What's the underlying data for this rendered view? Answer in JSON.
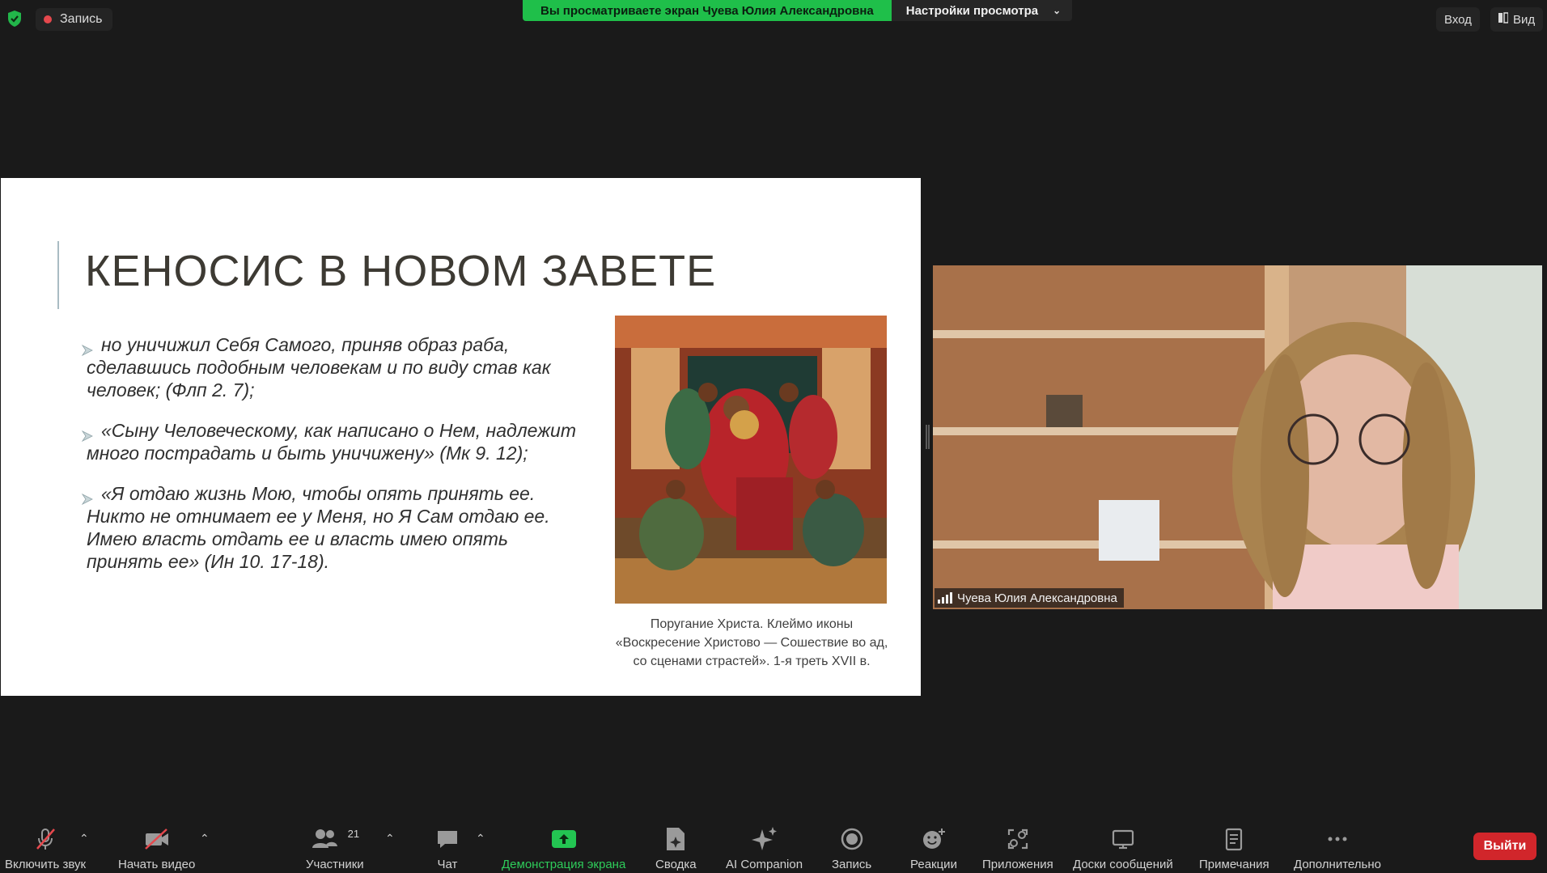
{
  "top_bar": {
    "recording_label": "Запись",
    "share_banner_text": "Вы просматриваете экран Чуева Юлия Александровна",
    "view_settings_label": "Настройки просмотра",
    "sign_in_label": "Вход",
    "view_label": "Вид"
  },
  "slide": {
    "title": "КЕНОСИС В НОВОМ ЗАВЕТЕ",
    "bullets": [
      "но уничижил Себя Самого, приняв образ раба, сделавшись подобным человекам и по виду став как человек; (Флп 2. 7);",
      "«Сыну Человеческому, как написано о Нем, надлежит много пострадать и быть уничижену» (Мк 9. 12);",
      "«Я отдаю жизнь Мою, чтобы опять принять ее. Никто не отнимает ее у Меня, но Я Сам отдаю ее. Имею власть отдать ее и власть имею опять принять ее» (Ин 10. 17-18)."
    ],
    "caption_lines": [
      "Поругание Христа. Клеймо иконы",
      "«Воскресение Христово — Сошествие во ад,",
      "со сценами страстей». 1-я треть XVII в."
    ]
  },
  "video": {
    "participant_name": "Чуева Юлия Александровна"
  },
  "toolbar": {
    "unmute_label": "Включить звук",
    "start_video_label": "Начать видео",
    "participants_label": "Участники",
    "participants_count": "21",
    "chat_label": "Чат",
    "share_screen_label": "Демонстрация экрана",
    "summary_label": "Сводка",
    "ai_label": "AI Companion",
    "record_label": "Запись",
    "reactions_label": "Реакции",
    "apps_label": "Приложения",
    "whiteboards_label": "Доски сообщений",
    "notes_label": "Примечания",
    "more_label": "Дополнительно",
    "leave_label": "Выйти"
  },
  "colors": {
    "share_banner": "#1fbf4a",
    "leave_button": "#d1262b",
    "share_screen_active": "#2ecc5a",
    "recording_dot": "#e5484d"
  },
  "icons": [
    "shield-icon",
    "record-dot-icon",
    "chevron-down-icon",
    "view-icon",
    "mic-muted-icon",
    "video-off-icon",
    "participants-icon",
    "chat-icon",
    "share-screen-icon",
    "summary-icon",
    "ai-sparkle-icon",
    "record-icon",
    "reactions-icon",
    "apps-icon",
    "whiteboard-icon",
    "notes-icon",
    "more-icon",
    "signal-bars-icon"
  ]
}
